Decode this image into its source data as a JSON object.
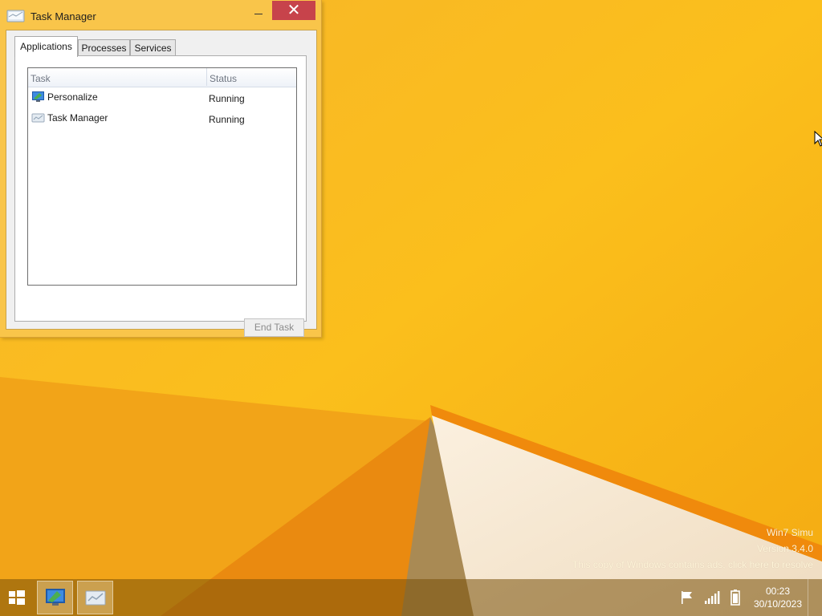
{
  "window": {
    "title": "Task Manager",
    "close_glyph": "✕",
    "tabs": [
      {
        "label": "Applications",
        "active": true
      },
      {
        "label": "Processes",
        "active": false
      },
      {
        "label": "Services",
        "active": false
      }
    ],
    "columns": {
      "task": "Task",
      "status": "Status"
    },
    "rows": [
      {
        "name": "Personalize",
        "status": "Running",
        "icon": "personalize-icon"
      },
      {
        "name": "Task Manager",
        "status": "Running",
        "icon": "task-manager-icon"
      }
    ],
    "end_task_label": "End Task"
  },
  "watermark": {
    "line1": "Win7 Simu",
    "line2": "Version 3.4.0",
    "line3": "This copy of Windows contains ads, click here to resolve"
  },
  "taskbar": {
    "apps": [
      "personalize-icon",
      "task-manager-icon"
    ],
    "tray_icons": [
      "flag-icon",
      "signal-icon",
      "battery-icon"
    ],
    "time": "00:23",
    "date": "30/10/2023"
  },
  "colors": {
    "accent_close": "#c7434b",
    "wallpaper": "#f7b520",
    "window_frame": "#f9c54a"
  }
}
